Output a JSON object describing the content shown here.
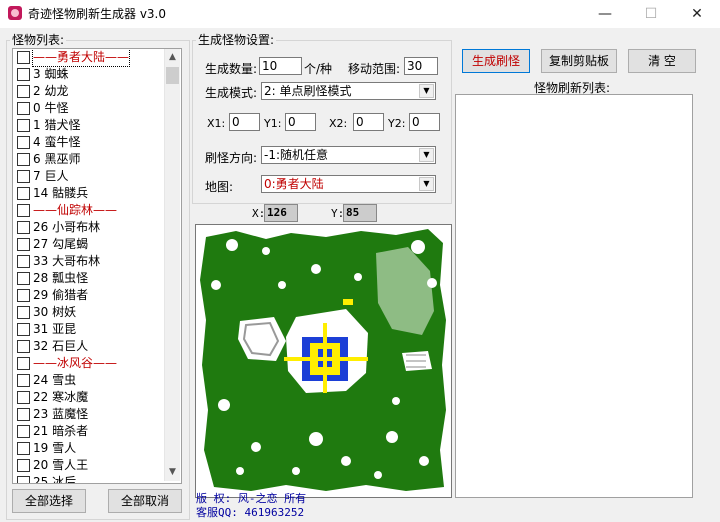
{
  "window": {
    "title": "奇迹怪物刷新生成器 v3.0",
    "minimize": "—",
    "maximize": "☐",
    "close": "✕"
  },
  "monster_list": {
    "legend": "怪物列表:",
    "items": [
      {
        "label": "——勇者大陆——",
        "type": "header",
        "selected": true
      },
      {
        "label": "3  蜘蛛",
        "type": "item"
      },
      {
        "label": "2  幼龙",
        "type": "item"
      },
      {
        "label": "0  牛怪",
        "type": "item"
      },
      {
        "label": "1  猎犬怪",
        "type": "item"
      },
      {
        "label": "4  蛮牛怪",
        "type": "item"
      },
      {
        "label": "6  黑巫师",
        "type": "item"
      },
      {
        "label": "7  巨人",
        "type": "item"
      },
      {
        "label": "14  骷髅兵",
        "type": "item"
      },
      {
        "label": "——仙踪林——",
        "type": "header"
      },
      {
        "label": "26  小哥布林",
        "type": "item"
      },
      {
        "label": "27  勾尾蝎",
        "type": "item"
      },
      {
        "label": "33  大哥布林",
        "type": "item"
      },
      {
        "label": "28  瓢虫怪",
        "type": "item"
      },
      {
        "label": "29  偷猎者",
        "type": "item"
      },
      {
        "label": "30  树妖",
        "type": "item"
      },
      {
        "label": "31  亚昆",
        "type": "item"
      },
      {
        "label": "32  石巨人",
        "type": "item"
      },
      {
        "label": "——冰风谷——",
        "type": "header"
      },
      {
        "label": "24  雪虫",
        "type": "item"
      },
      {
        "label": "22  寒冰魔",
        "type": "item"
      },
      {
        "label": "23  蓝魔怪",
        "type": "item"
      },
      {
        "label": "21  暗杀者",
        "type": "item"
      },
      {
        "label": "19  雪人",
        "type": "item"
      },
      {
        "label": "20  雪人王",
        "type": "item"
      },
      {
        "label": "25  冰后",
        "type": "item"
      }
    ],
    "select_all": "全部选择",
    "cancel_all": "全部取消"
  },
  "settings": {
    "legend": "生成怪物设置:",
    "count_label": "生成数量:",
    "count_value": "10",
    "count_unit": "个/种",
    "range_label": "移动范围:",
    "range_value": "30",
    "mode_label": "生成模式:",
    "mode_value": "2: 单点刷怪模式",
    "x1_label": "X1:",
    "x1_value": "0",
    "y1_label": "Y1:",
    "y1_value": "0",
    "x2_label": "X2:",
    "x2_value": "0",
    "y2_label": "Y2:",
    "y2_value": "0",
    "direction_label": "刷怪方向:",
    "direction_value": "-1:随机任意",
    "map_label": "地图:",
    "map_value": "0:勇者大陆"
  },
  "coords": {
    "x_label": "X:",
    "x_value": "126",
    "y_label": "Y:",
    "y_value": "85"
  },
  "actions": {
    "generate": "生成刷怪",
    "copy": "复制剪贴板",
    "clear": "清  空"
  },
  "refresh_list": {
    "title": "怪物刷新列表:"
  },
  "footer": {
    "copyright": "版  权: 风-之恋 所有",
    "qq": "客服QQ: 461963252"
  },
  "colors": {
    "map_green": "#1f7a0f",
    "map_yellow": "#ffee00",
    "map_blue": "#1c3fd6",
    "header_red": "#c00000"
  }
}
